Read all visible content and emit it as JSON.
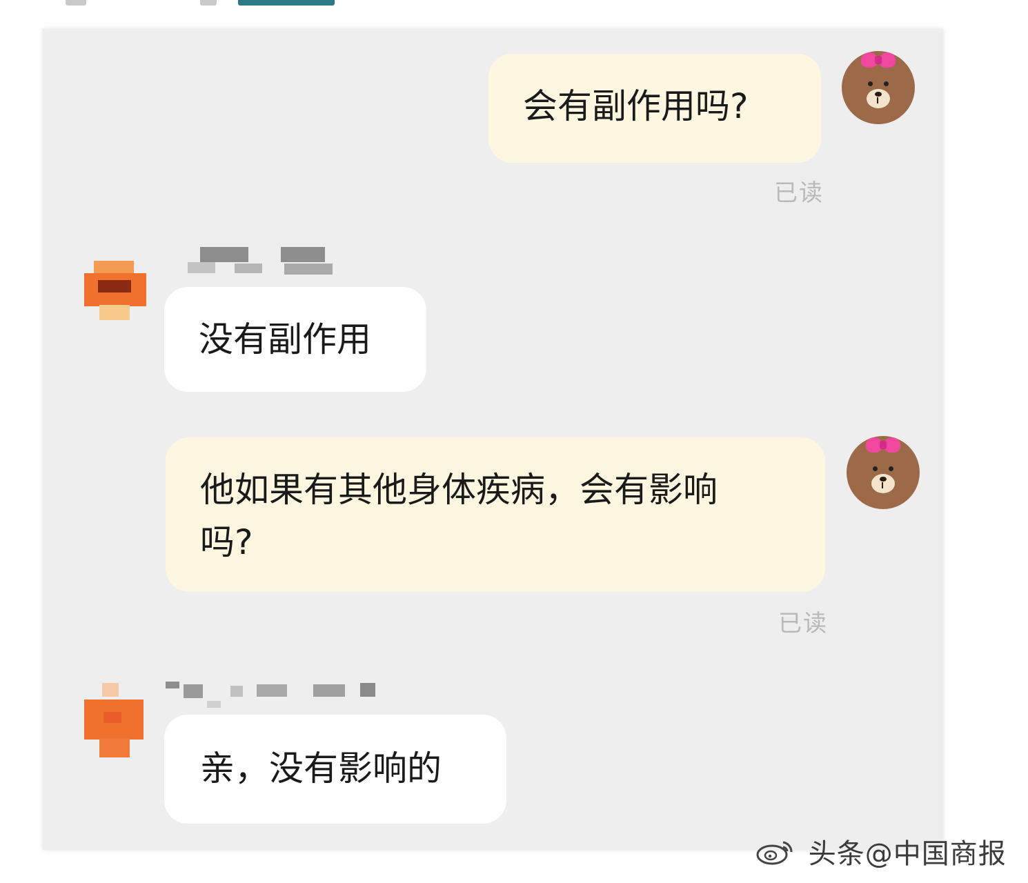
{
  "messages": [
    {
      "direction": "outgoing",
      "text": "会有副作用吗?",
      "status": "已读"
    },
    {
      "direction": "incoming",
      "text": "没有副作用"
    },
    {
      "direction": "outgoing",
      "text_line1": "他如果有其他身体疾病，会有影响",
      "text_line2": "吗?",
      "status": "已读"
    },
    {
      "direction": "incoming",
      "text": "亲，没有影响的"
    }
  ],
  "watermark": {
    "text": "头条@中国商报",
    "icon": "weibo-logo-icon"
  },
  "colors": {
    "panel_bg": "#eeeeee",
    "outgoing_bubble": "#fdf6e1",
    "incoming_bubble": "#ffffff",
    "read_status": "#b9b9b9",
    "avatar_orange": "#f0702e"
  }
}
